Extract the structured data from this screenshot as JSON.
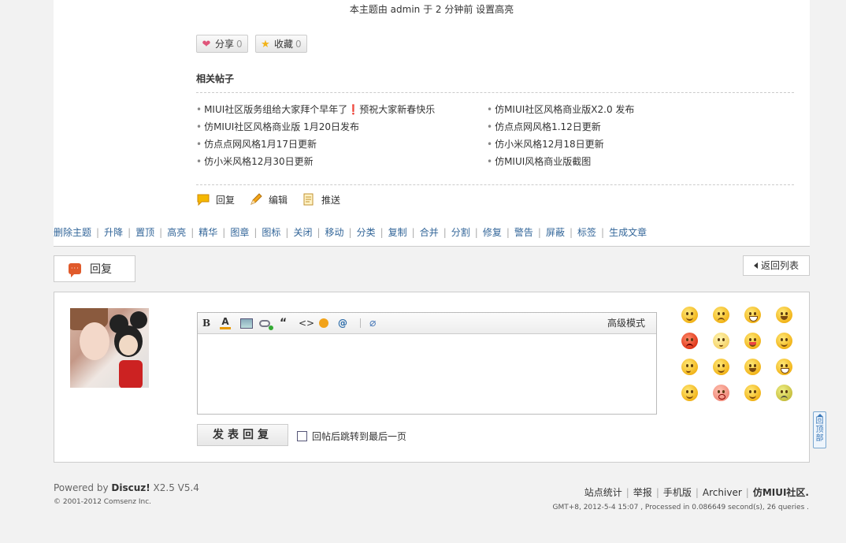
{
  "post": {
    "highlight_note": "本主题由 admin 于 2 分钟前 设置高亮",
    "share": {
      "label": "分享",
      "count": "0"
    },
    "favorite": {
      "label": "收藏",
      "count": "0"
    }
  },
  "related": {
    "title": "相关帖子",
    "left": [
      "MIUI社区版务组给大家拜个早年了❗预祝大家新春快乐",
      "仿MIUI社区风格商业版 1月20日发布",
      "仿点点网风格1月17日更新",
      "仿小米风格12月30日更新"
    ],
    "right": [
      "仿MIUI社区风格商业版X2.0 发布",
      "仿点点网风格1.12日更新",
      "仿小米风格12月18日更新",
      "仿MIUI风格商业版截图"
    ]
  },
  "actions": {
    "reply": "回复",
    "edit": "编辑",
    "push": "推送"
  },
  "moderation": [
    "删除主题",
    "升降",
    "置顶",
    "高亮",
    "精华",
    "图章",
    "图标",
    "关闭",
    "移动",
    "分类",
    "复制",
    "合并",
    "分割",
    "修复",
    "警告",
    "屏蔽",
    "标签",
    "生成文章"
  ],
  "reply_tab": "回复",
  "back_list": "返回列表",
  "editor": {
    "advanced_mode": "高级模式",
    "tb_bold": "B",
    "tb_color": "A",
    "tb_quote": "“",
    "tb_code": "<>",
    "tb_at": "@",
    "tb_attach": "⌀"
  },
  "submit": "发表回复",
  "jump_last": "回帖后跳转到最后一页",
  "smilies": [
    "smile",
    "frown",
    "grin",
    "sob",
    "angry",
    "puzzled",
    "tongue",
    "love",
    "thinking",
    "wink",
    "pain",
    "lol",
    "shy",
    "shocked",
    "evil",
    "sick"
  ],
  "footer": {
    "powered_prefix": "Powered by ",
    "powered_brand": "Discuz!",
    "powered_version": " X2.5 V5.4",
    "copyright": "© 2001-2012 Comsenz Inc.",
    "links": [
      "站点统计",
      "举报",
      "手机版",
      "Archiver"
    ],
    "site_name": "仿MIUI社区.",
    "time": "GMT+8, 2012-5-4 15:07 , Processed in 0.086649 second(s), 26 queries ."
  },
  "to_top": "回顶部",
  "colors": {
    "link": "#336699",
    "accent": "#e05a2b",
    "border": "#cccccc"
  }
}
